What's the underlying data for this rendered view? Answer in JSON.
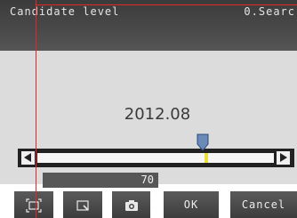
{
  "header": {
    "title_left": "Candidate level",
    "title_right": "0.Searc"
  },
  "main": {
    "value_text": "2012.08"
  },
  "slider": {
    "value": 70,
    "marker_fraction": 0.7
  },
  "readout": {
    "value": "70"
  },
  "toolbar": {
    "fit_icon": "fit-frame-icon",
    "zoom_icon": "zoom-window-icon",
    "camera_icon": "camera-icon",
    "ok_label": "OK",
    "cancel_label": "Cancel"
  },
  "colors": {
    "title_bg": "#444444",
    "panel_bg": "#dcdcdc",
    "marker": "#6a8ab8",
    "guide_lines": "#e32626"
  }
}
